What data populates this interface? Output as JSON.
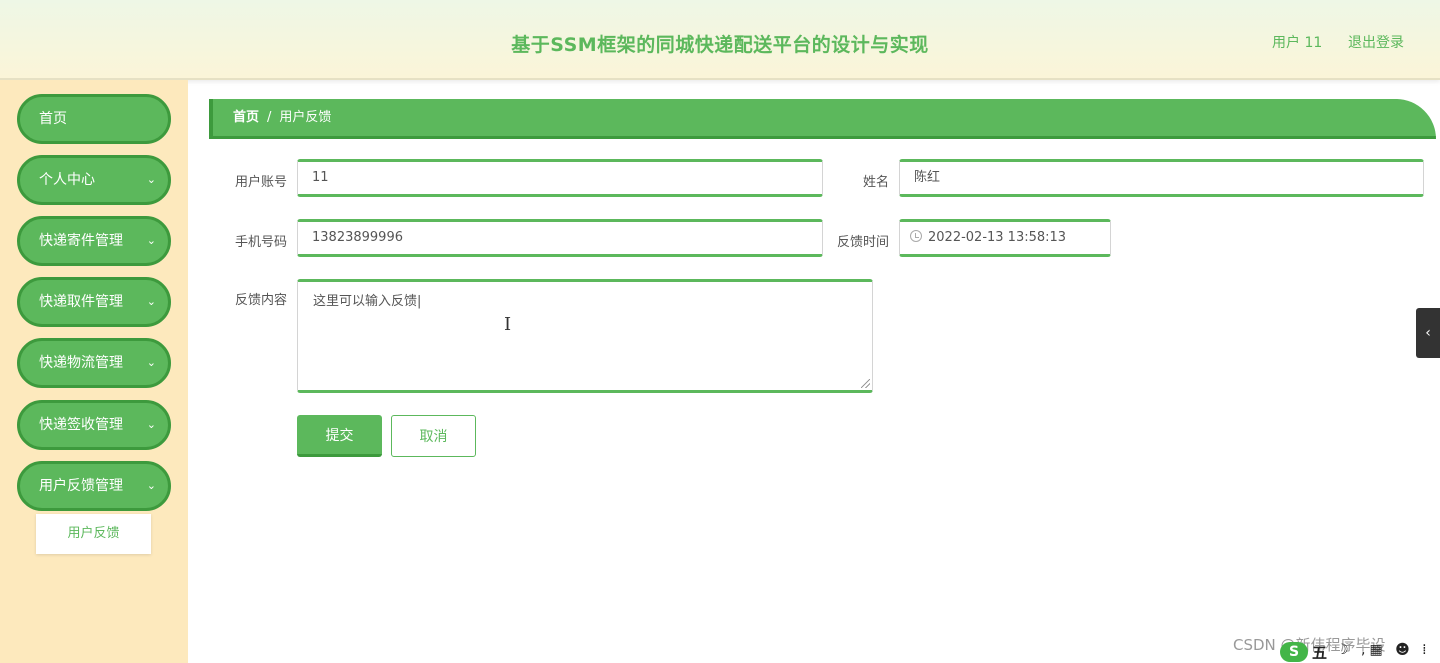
{
  "header": {
    "title": "基于SSM框架的同城快递配送平台的设计与实现",
    "user": "用户 11",
    "logout": "退出登录"
  },
  "sidebar": {
    "items": [
      {
        "label": "首页"
      },
      {
        "label": "个人中心",
        "chevron": "⌄"
      },
      {
        "label": "快递寄件管理",
        "chevron": "⌄"
      },
      {
        "label": "快递取件管理",
        "chevron": "⌄"
      },
      {
        "label": "快递物流管理",
        "chevron": "⌄"
      },
      {
        "label": "快递签收管理",
        "chevron": "⌄"
      },
      {
        "label": "用户反馈管理",
        "chevron": "⌄"
      }
    ],
    "submenu": {
      "label": "用户反馈"
    }
  },
  "breadcrumb": {
    "home": "首页",
    "separator": "/",
    "current": "用户反馈"
  },
  "form": {
    "account_label": "用户账号",
    "account_value": "11",
    "name_label": "姓名",
    "name_value": "陈红",
    "phone_label": "手机号码",
    "phone_value": "13823899996",
    "time_label": "反馈时间",
    "time_value": "2022-02-13 13:58:13",
    "content_label": "反馈内容",
    "content_value": "这里可以输入反馈|"
  },
  "buttons": {
    "submit": "提交",
    "cancel": "取消"
  },
  "side_toggle": "‹",
  "overlay": {
    "watermark": "CSDN @新伟程序毕设",
    "ime_logo": "S",
    "ime_mode": "五",
    "ime_icons": "☽ ,▦ ☻ ⁞"
  },
  "colors": {
    "accent": "#5cb85c",
    "accent_dark": "#3d9a3d",
    "sidebar_bg": "#fde9bd"
  }
}
